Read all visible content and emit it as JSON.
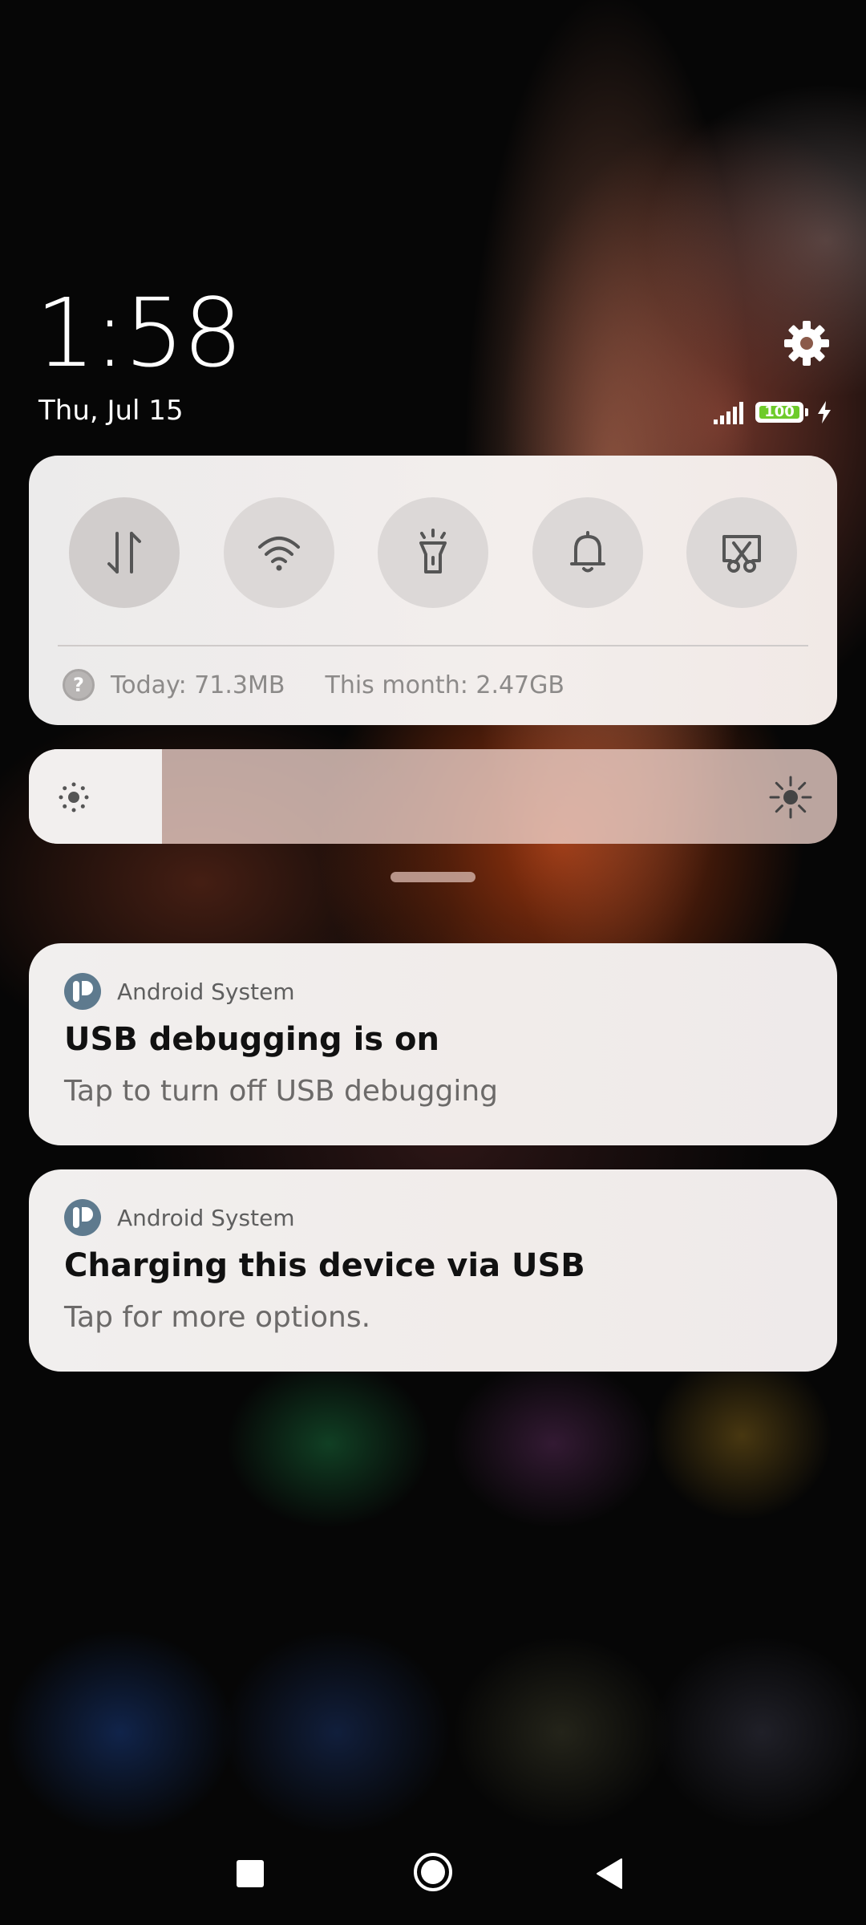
{
  "header": {
    "time": "1:58",
    "date": "Thu, Jul 15",
    "battery_level": "100",
    "battery_fraction": 1.0,
    "signal": "signal-bars-icon",
    "charging": "lightning-icon",
    "settings": "gear-icon"
  },
  "quick_settings": {
    "toggles": [
      {
        "name": "mobile-data",
        "icon": "mobile-data-icon",
        "active": true
      },
      {
        "name": "wifi",
        "icon": "wifi-icon",
        "active": false
      },
      {
        "name": "flashlight",
        "icon": "flashlight-icon",
        "active": false
      },
      {
        "name": "sound",
        "icon": "bell-icon",
        "active": false
      },
      {
        "name": "screenshot",
        "icon": "screenshot-icon",
        "active": false
      }
    ],
    "data_help_icon": "?",
    "data_today": "Today: 71.3MB",
    "data_month": "This month: 2.47GB"
  },
  "brightness": {
    "level": 0.165,
    "low_icon": "brightness-low-icon",
    "high_icon": "brightness-high-icon"
  },
  "notifications": [
    {
      "app": "Android System",
      "title": "USB debugging is on",
      "text": "Tap to turn off USB debugging"
    },
    {
      "app": "Android System",
      "title": "Charging this device via USB",
      "text": "Tap for more options."
    }
  ],
  "navbar": {
    "recents": "square-icon",
    "home": "circle-icon",
    "back": "triangle-back-icon"
  },
  "colors": {
    "panel": "#f1efee",
    "battery_fill": "#6ecb2a",
    "app_icon": "#5e7a8e"
  }
}
